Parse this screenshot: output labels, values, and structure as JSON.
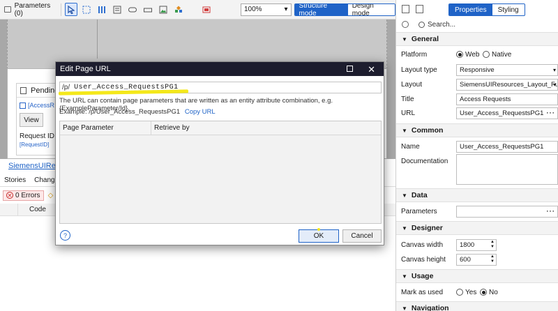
{
  "toolbar": {
    "parameters_label": "Parameters (0)",
    "zoom": "100%",
    "structure_mode": "Structure mode",
    "design_mode": "Design mode",
    "icons": [
      "select-icon",
      "container-icon",
      "layout-grid-icon",
      "data-view-icon",
      "text-box-icon",
      "link-icon",
      "image-icon",
      "widgets-icon",
      "snippet-icon"
    ]
  },
  "canvas": {
    "pending_label": "Pending",
    "access_label": "[AccessR",
    "view_button": "View",
    "request_id_label": "Request ID",
    "request_id_value": "[RequestID]"
  },
  "bottom": {
    "doc_link": "SiemensUIReso",
    "tabs": [
      "Stories",
      "Changes"
    ],
    "errors": "0 Errors",
    "code_col": "Code"
  },
  "dialog": {
    "title": "Edit Page URL",
    "url_prefix": "/p/",
    "url_value": "User_Access_RequestsPG1",
    "help_text": "The URL can contain page parameters that are written as an entity attribute combination, e.g. {ExampleParameter/Id}.",
    "example_label": "Example: /p/User_Access_RequestsPG1",
    "copy_url": "Copy URL",
    "col_param": "Page Parameter",
    "col_retrieve": "Retrieve by",
    "help_icon": "?",
    "ok": "OK",
    "cancel": "Cancel",
    "highlight_color": "#f4e81a"
  },
  "props": {
    "tab_properties": "Properties",
    "tab_styling": "Styling",
    "search_placeholder": "Search...",
    "general": "General",
    "platform_label": "Platform",
    "platform_web": "Web",
    "platform_native": "Native",
    "layout_type_label": "Layout type",
    "layout_type_value": "Responsive",
    "layout_label": "Layout",
    "layout_value": "SiemensUIResources_Layout_Fullw",
    "title_label": "Title",
    "title_value": "Access Requests",
    "url_label": "URL",
    "url_value": "User_Access_RequestsPG1",
    "common": "Common",
    "name_label": "Name",
    "name_value": "User_Access_RequestsPG1",
    "documentation_label": "Documentation",
    "data": "Data",
    "parameters_label": "Parameters",
    "designer": "Designer",
    "canvas_width_label": "Canvas width",
    "canvas_width_value": "1800",
    "canvas_height_label": "Canvas height",
    "canvas_height_value": "600",
    "usage": "Usage",
    "mark_used_label": "Mark as used",
    "yes": "Yes",
    "no": "No",
    "navigation": "Navigation"
  }
}
